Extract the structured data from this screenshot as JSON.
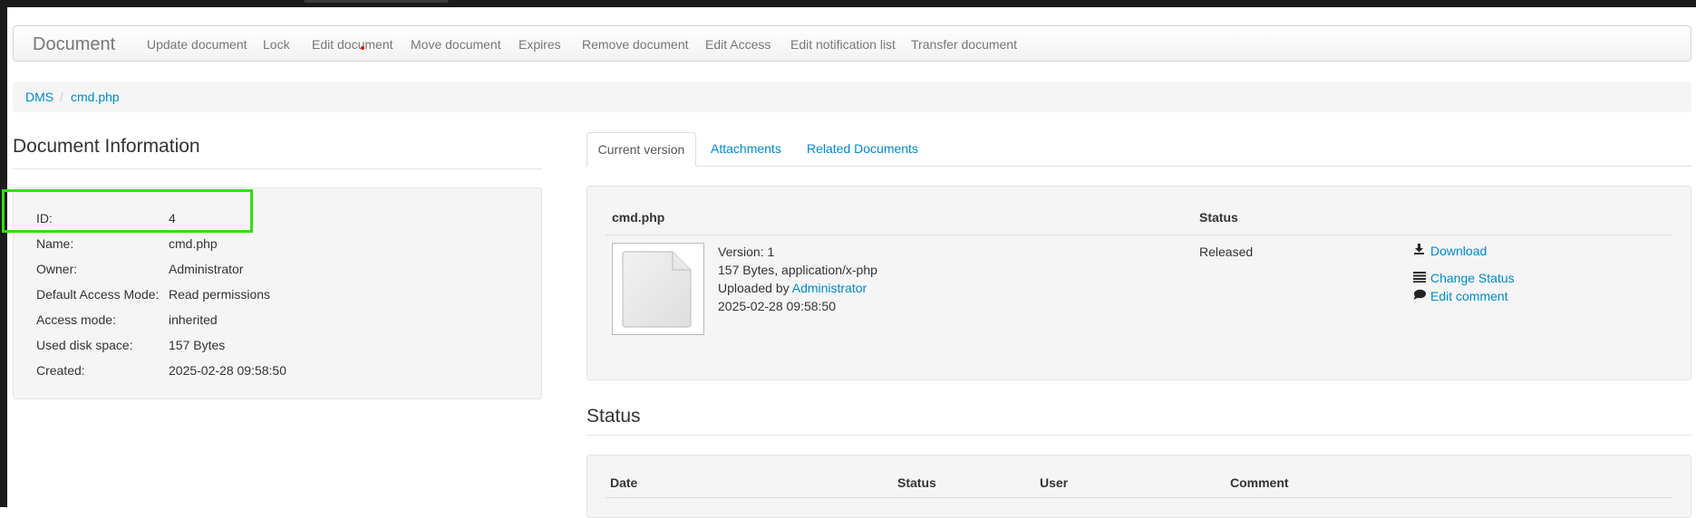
{
  "navbar": {
    "brand": "Document",
    "items": [
      "Update document",
      "Lock",
      "Edit document",
      "Move document",
      "Expires",
      "Remove document",
      "Edit Access",
      "Edit notification list",
      "Transfer document"
    ]
  },
  "breadcrumb": {
    "root": "DMS",
    "separator": "/",
    "current": "cmd.php"
  },
  "document_info": {
    "title": "Document Information",
    "rows": [
      {
        "label": "ID:",
        "value": "4"
      },
      {
        "label": "Name:",
        "value": "cmd.php"
      },
      {
        "label": "Owner:",
        "value": "Administrator"
      },
      {
        "label": "Default Access Mode:",
        "value": "Read permissions"
      },
      {
        "label": "Access mode:",
        "value": "inherited"
      },
      {
        "label": "Used disk space:",
        "value": "157 Bytes"
      },
      {
        "label": "Created:",
        "value": "2025-02-28 09:58:50"
      }
    ]
  },
  "tabs": [
    "Current version",
    "Attachments",
    "Related Documents"
  ],
  "current_version": {
    "col_name": "cmd.php",
    "col_status": "Status",
    "version_line": "Version: 1",
    "size_line": "157 Bytes, application/x-php",
    "uploaded_prefix": "Uploaded by",
    "uploaded_by": "Administrator",
    "date": "2025-02-28 09:58:50",
    "status": "Released",
    "actions": [
      {
        "icon": "download-icon",
        "label": "Download"
      },
      {
        "icon": "list-icon",
        "label": "Change Status"
      },
      {
        "icon": "comment-icon",
        "label": "Edit comment"
      }
    ]
  },
  "status_section": {
    "title": "Status",
    "headers": [
      "Date",
      "Status",
      "User",
      "Comment"
    ]
  }
}
